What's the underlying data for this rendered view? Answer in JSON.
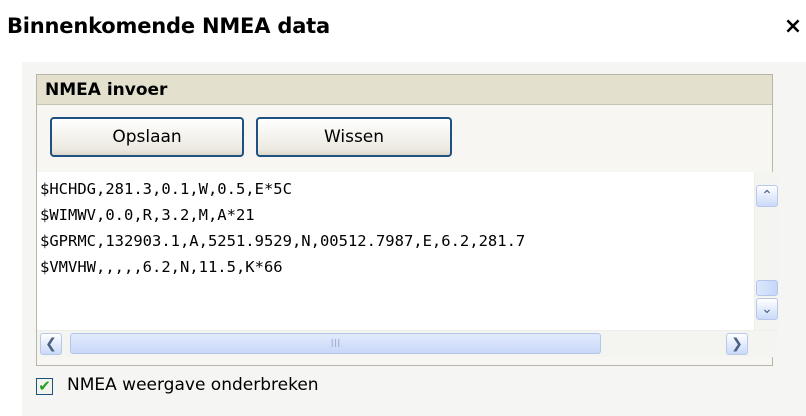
{
  "dialog": {
    "title": "Binnenkomende NMEA data",
    "close_glyph": "×"
  },
  "group": {
    "header": "NMEA invoer",
    "buttons": {
      "save_label": "Opslaan",
      "clear_label": "Wissen"
    },
    "nmea_lines": [
      "$HCHDG,281.3,0.1,W,0.5,E*5C",
      "$WIMWV,0.0,R,3.2,M,A*21",
      "$GPRMC,132903.1,A,5251.9529,N,00512.7987,E,6.2,281.7",
      "$VMVHW,,,,,6.2,N,11.5,K*66"
    ]
  },
  "scrollbars": {
    "up_glyph": "⌃",
    "down_glyph": "⌄",
    "left_glyph": "❮",
    "right_glyph": "❯",
    "grip_glyph": "III"
  },
  "checkbox": {
    "label": "NMEA weergave onderbreken",
    "checked": true,
    "check_glyph": "✔"
  },
  "colors": {
    "header_bg": "#e3e0ce",
    "button_border": "#1c5180",
    "scrollbar_accent": "#c9d9f8",
    "checkmark": "#21a121"
  }
}
